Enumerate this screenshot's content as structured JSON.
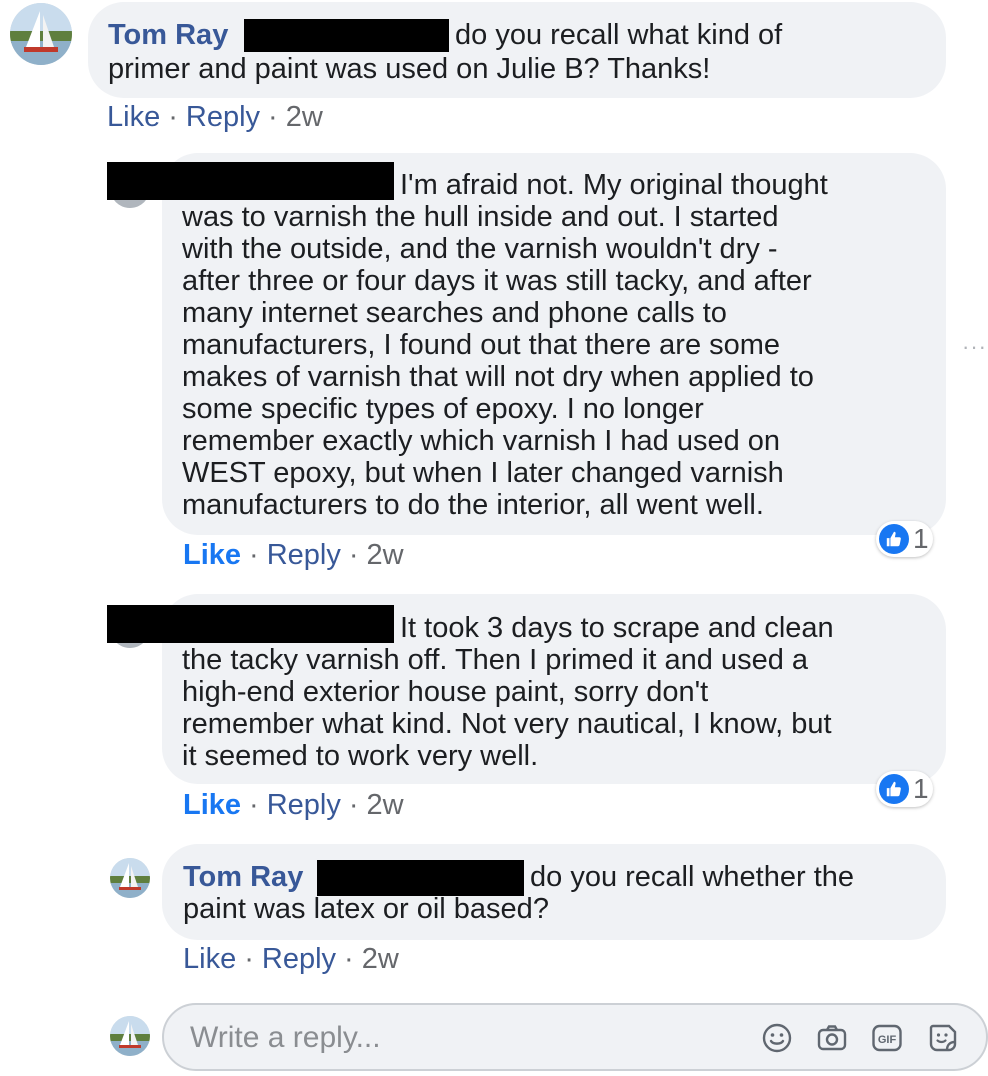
{
  "comments": [
    {
      "author": "Tom Ray",
      "line1": "do you recall what kind of",
      "line2": "primer and paint was used on Julie B? Thanks!",
      "actions": {
        "like": "Like",
        "reply": "Reply",
        "time": "2w",
        "sep": "·"
      }
    },
    {
      "first_line": "I'm afraid not. My original thought",
      "lines": [
        "was to varnish the hull inside and out. I started",
        "with the outside, and the varnish wouldn't dry -",
        "after three or four days it was still tacky, and after",
        "many internet searches and phone calls to",
        "manufacturers, I found out that there are some",
        "makes of varnish that will not dry when applied to",
        "some specific types of epoxy. I no longer",
        "remember exactly which varnish I had used on",
        "WEST epoxy, but when I later changed varnish",
        "manufacturers to do the interior, all went well."
      ],
      "reaction_count": "1",
      "actions": {
        "like": "Like",
        "reply": "Reply",
        "time": "2w",
        "sep": "·"
      }
    },
    {
      "first_line": "It took 3 days to scrape and clean",
      "lines": [
        "the tacky varnish off. Then I primed it and used a",
        "high-end exterior house paint, sorry don't",
        "remember what kind. Not very nautical, I know, but",
        "it seemed to work very well."
      ],
      "reaction_count": "1",
      "actions": {
        "like": "Like",
        "reply": "Reply",
        "time": "2w",
        "sep": "·"
      }
    },
    {
      "author": "Tom Ray",
      "line1": "do you recall whether the",
      "line2": "paint was latex or oil based?",
      "actions": {
        "like": "Like",
        "reply": "Reply",
        "time": "2w",
        "sep": "·"
      }
    }
  ],
  "more_options": "···",
  "composer": {
    "placeholder": "Write a reply...",
    "icons": [
      "emoji-icon",
      "camera-icon",
      "gif-icon",
      "sticker-icon"
    ],
    "gif_label": "GIF"
  },
  "colors": {
    "bubble": "#f0f2f5",
    "author": "#385898",
    "like_active": "#1877f2",
    "meta": "#65676b"
  }
}
